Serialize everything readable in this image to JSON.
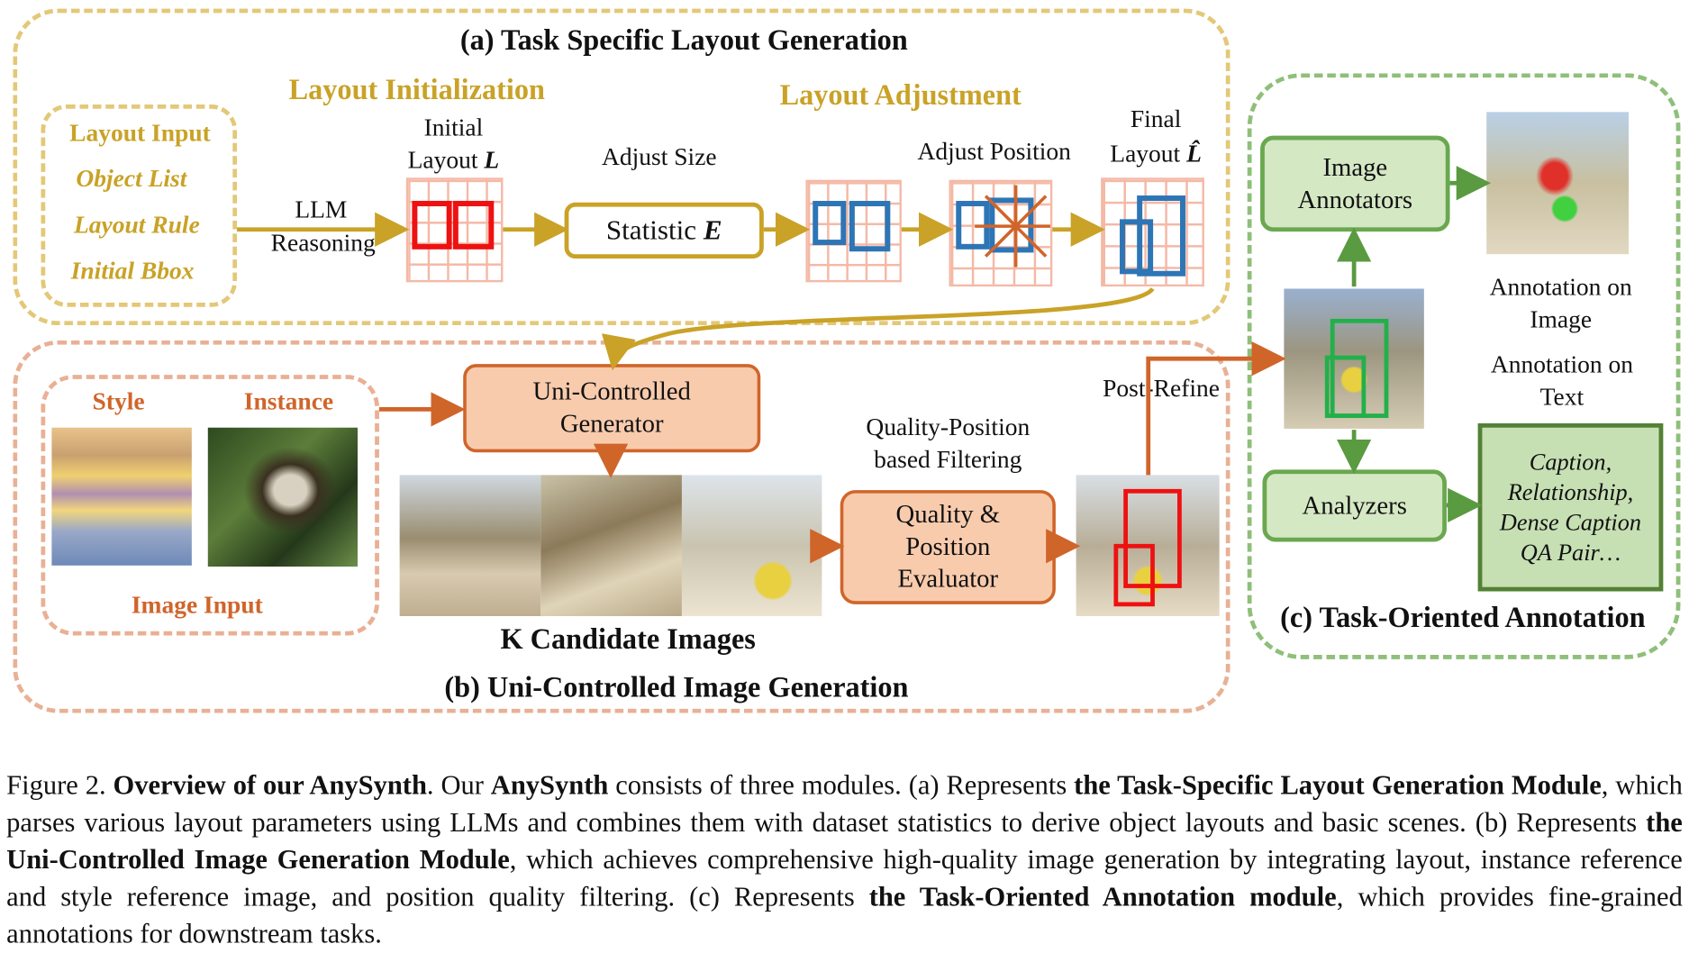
{
  "module_a": {
    "title": "(a) Task Specific Layout Generation",
    "layout_initialization": "Layout Initialization",
    "layout_adjustment": "Layout Adjustment",
    "layout_input": {
      "heading": "Layout Input",
      "items": [
        "Object List",
        "Layout Rule",
        "Initial Bbox"
      ]
    },
    "llm_reasoning": [
      "LLM",
      "Reasoning"
    ],
    "initial_layout": [
      "Initial",
      "Layout"
    ],
    "initial_layout_symbol": "L",
    "adjust_size": "Adjust Size",
    "statistic": "Statistic",
    "statistic_symbol": "E",
    "adjust_position": "Adjust Position",
    "final_layout": [
      "Final",
      "Layout"
    ],
    "final_layout_symbol": "L̂"
  },
  "module_b": {
    "title": "(b) Uni-Controlled Image Generation",
    "style": "Style",
    "instance": "Instance",
    "image_input": "Image Input",
    "generator": [
      "Uni-Controlled",
      "Generator"
    ],
    "candidates": "K Candidate Images",
    "filtering": [
      "Quality-Position",
      "based Filtering"
    ],
    "evaluator": [
      "Quality &",
      "Position",
      "Evaluator"
    ],
    "post_refine": "Post-Refine"
  },
  "module_c": {
    "title": "(c) Task-Oriented Annotation",
    "image_annotators": [
      "Image",
      "Annotators"
    ],
    "analyzers": "Analyzers",
    "annotation_image": [
      "Annotation on",
      "Image"
    ],
    "annotation_text": [
      "Annotation on",
      "Text"
    ],
    "outputs": [
      "Caption,",
      "Relationship,",
      "Dense Caption",
      "QA Pair…"
    ]
  },
  "caption": [
    {
      "t": "Figure 2. ",
      "b": false
    },
    {
      "t": "Overview of our AnySynth",
      "b": true
    },
    {
      "t": ". Our ",
      "b": false
    },
    {
      "t": "AnySynth",
      "b": true
    },
    {
      "t": " consists of three modules. (a) Represents ",
      "b": false
    },
    {
      "t": "the Task-Specific Layout Generation Module",
      "b": true
    },
    {
      "t": ", which parses various layout parameters using LLMs and combines them with dataset statistics to derive object layouts and basic scenes.  (b) Represents ",
      "b": false
    },
    {
      "t": "the Uni-Controlled Image Generation Module",
      "b": true
    },
    {
      "t": ", which achieves comprehensive high-quality image generation by integrating layout, instance reference and style reference image, and position quality filtering.  (c) Represents ",
      "b": false
    },
    {
      "t": "the Task-Oriented Annotation module",
      "b": true
    },
    {
      "t": ", which provides fine-grained annotations for downstream tasks.",
      "b": false
    }
  ],
  "colors": {
    "gold": "#c9a227",
    "orange": "#d0652a",
    "green": "#6aa84f",
    "red": "#ee1111",
    "blue": "#2e75b6"
  }
}
